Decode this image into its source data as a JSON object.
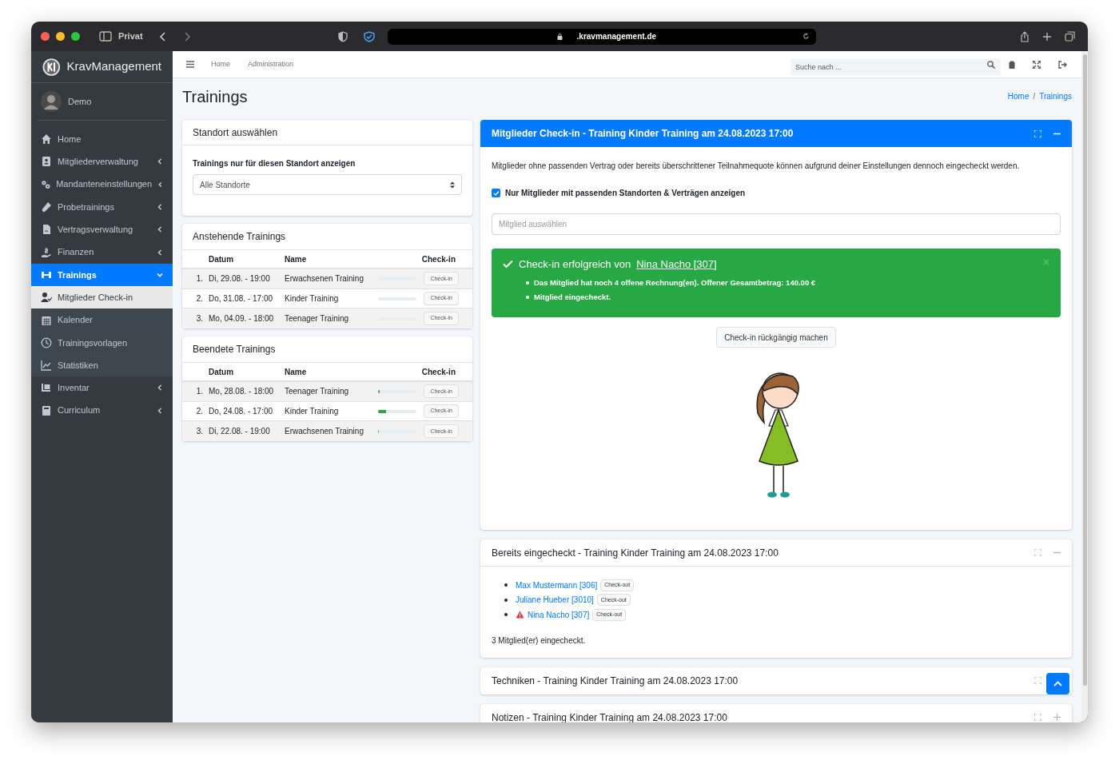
{
  "browser": {
    "profile": "Privat",
    "url": ".kravmanagement.de"
  },
  "brand": "KravManagement",
  "user": "Demo",
  "sidebar": {
    "items": [
      {
        "label": "Home",
        "selected": false
      },
      {
        "label": "Mitgliederverwaltung",
        "expandable": true,
        "expanded": false,
        "selected": false
      },
      {
        "label": "Mandanteneinstellungen",
        "expandable": true,
        "expanded": false,
        "selected": false
      },
      {
        "label": "Probetrainings",
        "expandable": true,
        "expanded": false,
        "selected": false
      },
      {
        "label": "Vertragsverwaltung",
        "expandable": true,
        "expanded": false,
        "selected": false
      },
      {
        "label": "Finanzen",
        "expandable": true,
        "expanded": false,
        "selected": false
      },
      {
        "label": "Trainings",
        "expandable": true,
        "expanded": true,
        "selected": true,
        "children": [
          {
            "label": "Mitglieder Check-in",
            "selected": true
          },
          {
            "label": "Kalender",
            "selected": false
          },
          {
            "label": "Trainingsvorlagen",
            "selected": false
          },
          {
            "label": "Statistiken",
            "selected": false
          }
        ]
      },
      {
        "label": "Inventar",
        "expandable": true,
        "expanded": false,
        "selected": false
      },
      {
        "label": "Curriculum",
        "expandable": true,
        "expanded": false,
        "selected": false
      }
    ]
  },
  "navbar": {
    "links": [
      "Home",
      "Administration"
    ],
    "search": {
      "placeholder": "Suche nach ..."
    }
  },
  "page_title": "Trainings",
  "breadcrumb": {
    "items": [
      "Home",
      "Trainings"
    ],
    "separator": "/"
  },
  "location_card": {
    "title": "Standort auswählen",
    "label": "Trainings nur für diesen Standort anzeigen",
    "select_value": "Alle Standorte"
  },
  "training_tables": [
    {
      "title": "Anstehende Trainings",
      "columns": [
        "Datum",
        "Name",
        "Check-in"
      ],
      "rows": [
        {
          "index": "1.",
          "date": "Di, 29.08. - 19:00",
          "name": "Erwachsenen Training",
          "level": 0,
          "button": "Check-in"
        },
        {
          "index": "2.",
          "date": "Do, 31.08. - 17:00",
          "name": "Kinder Training",
          "level": 0,
          "button": "Check-in"
        },
        {
          "index": "3.",
          "date": "Mo, 04.09. - 18:00",
          "name": "Teenager Training",
          "level": 0,
          "button": "Check-in"
        }
      ]
    },
    {
      "title": "Beendete Trainings",
      "columns": [
        "Datum",
        "Name",
        "Check-in"
      ],
      "rows": [
        {
          "index": "1.",
          "date": "Mo, 28.08. - 18:00",
          "name": "Teenager Training",
          "level": 0.05,
          "button": "Check-in"
        },
        {
          "index": "2.",
          "date": "Do, 24.08. - 17:00",
          "name": "Kinder Training",
          "level": 0.2,
          "button": "Check-in"
        },
        {
          "index": "3.",
          "date": "Di, 22.08. - 19:00",
          "name": "Erwachsenen Training",
          "level": 0.03,
          "button": "Check-in"
        }
      ]
    }
  ],
  "checkin_card": {
    "title": "Mitglieder Check-in - Training Kinder Training am 24.08.2023 17:00",
    "note": "Mitglieder ohne passenden Vertrag oder bereits überschrittener Teilnahmequote können aufgrund deiner Einstellungen dennoch eingecheckt werden.",
    "filter": {
      "label": "Nur Mitglieder mit passenden Standorten & Verträgen anzeigen",
      "checked": true
    },
    "member_field": {
      "placeholder": "Mitglied auswählen"
    },
    "alert": {
      "title": "Check-in erfolgreich von",
      "member": "Nina Nacho [307]",
      "items": [
        "Das Mitglied hat noch 4 offene Rechnung(en). Offener Gesamtbetrag: 140.00 €",
        "Mitglied eingecheckt."
      ]
    },
    "undo_button": "Check-in rückgängig machen"
  },
  "checked_in_card": {
    "title": "Bereits eingecheckt - Training Kinder Training am 24.08.2023 17:00",
    "members": [
      {
        "name": "Max Mustermann [306]",
        "warning": false,
        "button": "Check-out"
      },
      {
        "name": "Juliane Hueber [3010]",
        "warning": false,
        "button": "Check-out"
      },
      {
        "name": "Nina Nacho [307]",
        "warning": true,
        "button": "Check-out"
      }
    ],
    "summary": "3 Mitglied(er) eingecheckt."
  },
  "collapsed_cards": [
    {
      "title": "Techniken - Training Kinder Training am 24.08.2023 17:00"
    },
    {
      "title": "Notizen - Training Kinder Training am 24.08.2023 17:00",
      "collapsed": true
    }
  ]
}
